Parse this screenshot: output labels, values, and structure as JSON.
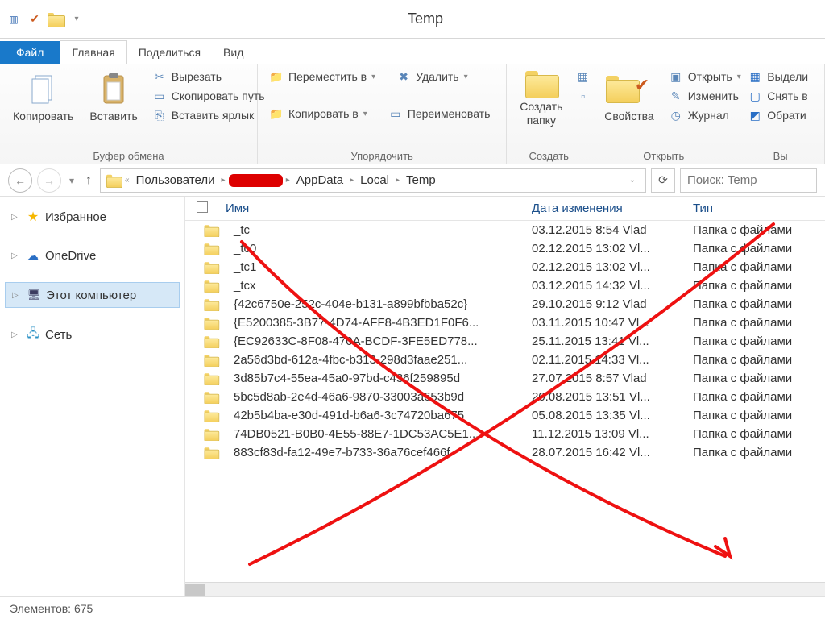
{
  "window": {
    "title": "Temp"
  },
  "tabs": {
    "file": "Файл",
    "home": "Главная",
    "share": "Поделиться",
    "view": "Вид"
  },
  "ribbon": {
    "clipboard": {
      "copy": "Копировать",
      "paste": "Вставить",
      "cut": "Вырезать",
      "copypath": "Скопировать путь",
      "pasteshortcut": "Вставить ярлык",
      "group": "Буфер обмена"
    },
    "organize": {
      "moveto": "Переместить в",
      "copyto": "Копировать в",
      "delete": "Удалить",
      "rename": "Переименовать",
      "group": "Упорядочить"
    },
    "new": {
      "newfolder": "Создать\nпапку",
      "group": "Создать"
    },
    "open": {
      "properties": "Свойства",
      "open": "Открыть",
      "edit": "Изменить",
      "history": "Журнал",
      "group": "Открыть"
    },
    "select": {
      "selectall": "Выдели",
      "selectnone": "Снять в",
      "invert": "Обрати",
      "group": "Вы"
    }
  },
  "nav": {
    "crumbs": [
      "Пользователи",
      "(redacted)",
      "AppData",
      "Local",
      "Temp"
    ],
    "searchPlaceholder": "Поиск: Temp"
  },
  "sidebar": {
    "favorites": "Избранное",
    "onedrive": "OneDrive",
    "thispc": "Этот компьютер",
    "network": "Сеть"
  },
  "columns": {
    "name": "Имя",
    "date": "Дата изменения",
    "type": "Тип"
  },
  "folderTypeLabel": "Папка с файлами",
  "rows": [
    {
      "name": "_tc",
      "date": "03.12.2015 8:54 Vlad"
    },
    {
      "name": "_tc0",
      "date": "02.12.2015 13:02 Vl..."
    },
    {
      "name": "_tc1",
      "date": "02.12.2015 13:02 Vl..."
    },
    {
      "name": "_tcx",
      "date": "03.12.2015 14:32 Vl..."
    },
    {
      "name": "{42c6750e-252c-404e-b131-a899bfbba52c}",
      "date": "29.10.2015 9:12 Vlad"
    },
    {
      "name": "{E5200385-3B77-4D74-AFF8-4B3ED1F0F6...",
      "date": "03.11.2015 10:47 Vl..."
    },
    {
      "name": "{EC92633C-8F08-470A-BCDF-3FE5ED778...",
      "date": "25.11.2015 13:41 Vl..."
    },
    {
      "name": "2a56d3bd-612a-4fbc-b313-298d3faae251...",
      "date": "02.11.2015 14:33 Vl..."
    },
    {
      "name": "3d85b7c4-55ea-45a0-97bd-c436f259895d",
      "date": "27.07.2015 8:57 Vlad"
    },
    {
      "name": "5bc5d8ab-2e4d-46a6-9870-33003a653b9d",
      "date": "20.08.2015 13:51 Vl..."
    },
    {
      "name": "42b5b4ba-e30d-491d-b6a6-3c74720ba675",
      "date": "05.08.2015 13:35 Vl..."
    },
    {
      "name": "74DB0521-B0B0-4E55-88E7-1DC53AC5E1...",
      "date": "11.12.2015 13:09 Vl..."
    },
    {
      "name": "883cf83d-fa12-49e7-b733-36a76cef466f",
      "date": "28.07.2015 16:42 Vl..."
    }
  ],
  "status": {
    "items": "Элементов: 675"
  }
}
